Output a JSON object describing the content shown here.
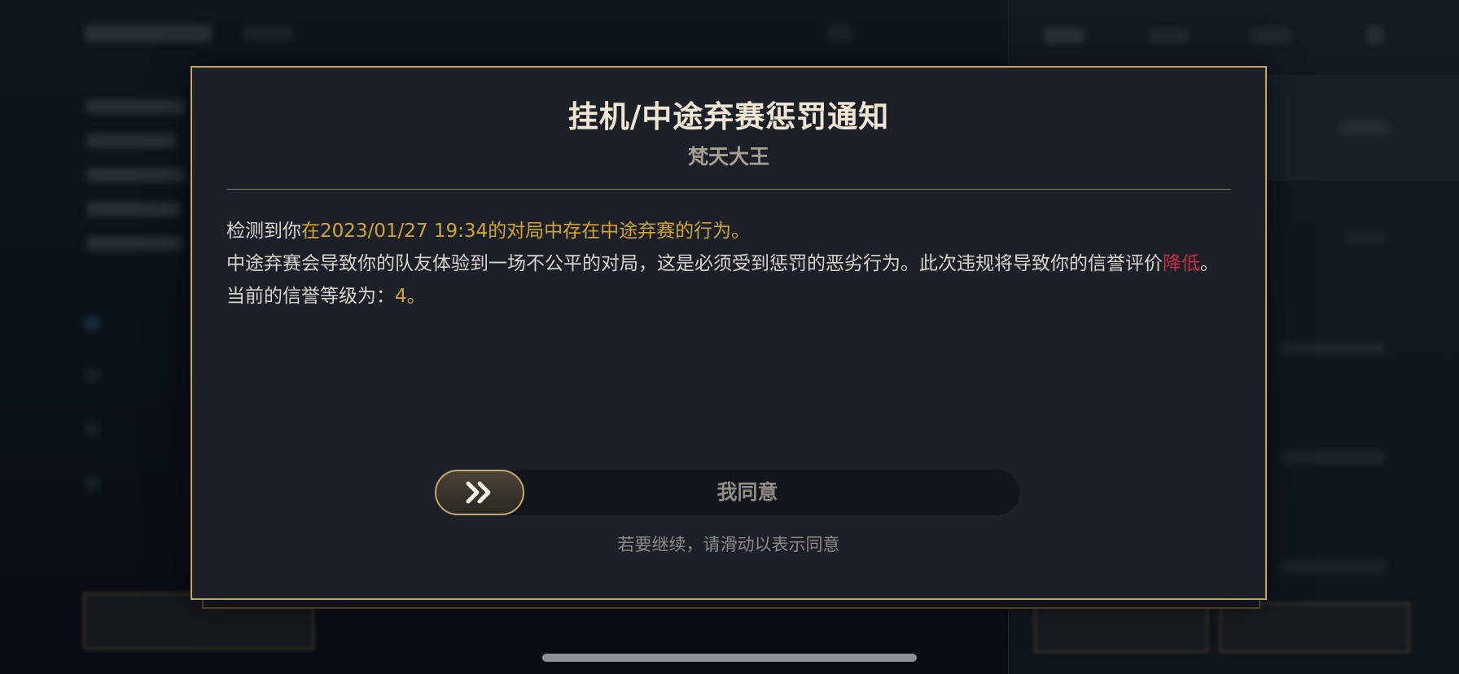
{
  "dialog": {
    "title": "挂机/中途弃赛惩罚通知",
    "subtitle": "梵天大王",
    "line1_prefix": "检测到你",
    "line1_highlight": "在2023/01/27 19:34的对局中存在中途弃赛的行为。",
    "line2_main": "中途弃赛会导致你的队友体验到一场不公平的对局，这是必须受到惩罚的恶劣行为。此次违规将导致你的信誉评价",
    "line2_highlight": "降低",
    "line2_end": "。",
    "line3_prefix": "当前的信誉等级为：",
    "line3_value": "4。",
    "slider_label": "我同意",
    "slider_icon": "double-chevron-right-icon",
    "hint": "若要继续，请滑动以表示同意"
  },
  "colors": {
    "border_gold": "#c4a35e",
    "highlight_gold": "#d2a435",
    "highlight_red": "#c6303e",
    "dialog_bg": "#1b2029"
  }
}
